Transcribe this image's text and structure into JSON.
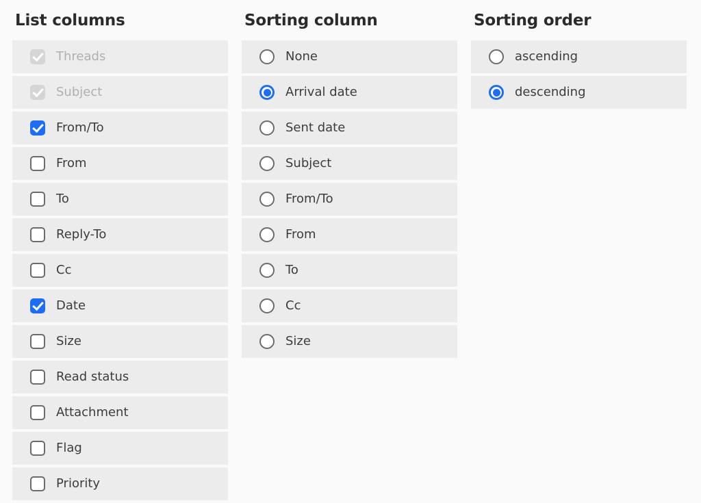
{
  "list_columns": {
    "title": "List columns",
    "items": [
      {
        "label": "Threads",
        "control": "checkbox",
        "checked": true,
        "disabled": true
      },
      {
        "label": "Subject",
        "control": "checkbox",
        "checked": true,
        "disabled": true
      },
      {
        "label": "From/To",
        "control": "checkbox",
        "checked": true,
        "disabled": false
      },
      {
        "label": "From",
        "control": "checkbox",
        "checked": false,
        "disabled": false
      },
      {
        "label": "To",
        "control": "checkbox",
        "checked": false,
        "disabled": false
      },
      {
        "label": "Reply-To",
        "control": "checkbox",
        "checked": false,
        "disabled": false
      },
      {
        "label": "Cc",
        "control": "checkbox",
        "checked": false,
        "disabled": false
      },
      {
        "label": "Date",
        "control": "checkbox",
        "checked": true,
        "disabled": false
      },
      {
        "label": "Size",
        "control": "checkbox",
        "checked": false,
        "disabled": false
      },
      {
        "label": "Read status",
        "control": "checkbox",
        "checked": false,
        "disabled": false
      },
      {
        "label": "Attachment",
        "control": "checkbox",
        "checked": false,
        "disabled": false
      },
      {
        "label": "Flag",
        "control": "checkbox",
        "checked": false,
        "disabled": false
      },
      {
        "label": "Priority",
        "control": "checkbox",
        "checked": false,
        "disabled": false
      }
    ]
  },
  "sorting_column": {
    "title": "Sorting column",
    "items": [
      {
        "label": "None",
        "control": "radio",
        "selected": false
      },
      {
        "label": "Arrival date",
        "control": "radio",
        "selected": true
      },
      {
        "label": "Sent date",
        "control": "radio",
        "selected": false
      },
      {
        "label": "Subject",
        "control": "radio",
        "selected": false
      },
      {
        "label": "From/To",
        "control": "radio",
        "selected": false
      },
      {
        "label": "From",
        "control": "radio",
        "selected": false
      },
      {
        "label": "To",
        "control": "radio",
        "selected": false
      },
      {
        "label": "Cc",
        "control": "radio",
        "selected": false
      },
      {
        "label": "Size",
        "control": "radio",
        "selected": false
      }
    ]
  },
  "sorting_order": {
    "title": "Sorting order",
    "items": [
      {
        "label": "ascending",
        "control": "radio",
        "selected": false
      },
      {
        "label": "descending",
        "control": "radio",
        "selected": true
      }
    ]
  },
  "colors": {
    "accent": "#1d6ef5",
    "row_background": "#ececec",
    "page_background": "#fafafa",
    "label": "#3c3c3c",
    "label_disabled": "#b0b0b0",
    "title": "#2b2b2b"
  }
}
